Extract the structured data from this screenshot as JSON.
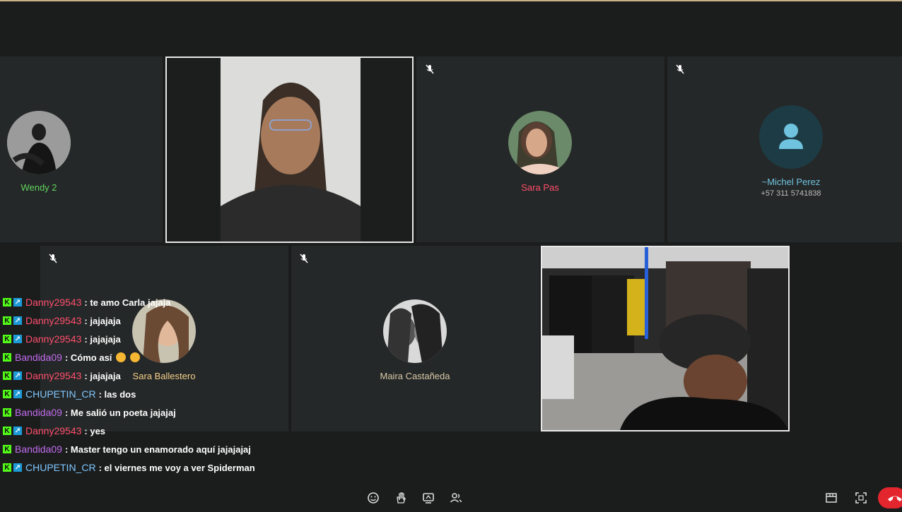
{
  "participants": {
    "wendy": {
      "name": "Wendy 2",
      "name_color": "#5fd45f"
    },
    "sara_pas": {
      "name": "Sara Pas",
      "name_color": "#ff4d6a"
    },
    "michel": {
      "name": "~Michel Perez",
      "phone": "+57 311 5741838",
      "name_color": "#6fc3df"
    },
    "sara_ballestero": {
      "name": "Sara Ballestero",
      "name_color": "#f5d08a"
    },
    "maira": {
      "name": "Maira Castañeda",
      "name_color": "#d8c8a8"
    }
  },
  "chat": {
    "messages": [
      {
        "user": "Danny29543",
        "color": "#ff4f6d",
        "text": ": te amo Carla jajaja",
        "badge2": true,
        "emojis": []
      },
      {
        "user": "Danny29543",
        "color": "#ff4f6d",
        "text": ": jajajaja",
        "badge2": true,
        "emojis": []
      },
      {
        "user": "Danny29543",
        "color": "#ff4f6d",
        "text": ": jajajaja",
        "badge2": true,
        "emojis": []
      },
      {
        "user": "Bandida09",
        "color": "#c36cf0",
        "text": ": Cómo así",
        "badge2": false,
        "emojis": [
          "#f7b733",
          "#f7b733"
        ]
      },
      {
        "user": "Danny29543",
        "color": "#ff4f6d",
        "text": ": jajajaja",
        "badge2": true,
        "emojis": []
      },
      {
        "user": "CHUPETIN_CR",
        "color": "#7fc7ff",
        "text": ": las dos",
        "badge2": true,
        "emojis": []
      },
      {
        "user": "Bandida09",
        "color": "#c36cf0",
        "text": ": Me salió un poeta jajajaj",
        "badge2": false,
        "emojis": []
      },
      {
        "user": "Danny29543",
        "color": "#ff4f6d",
        "text": ": yes",
        "badge2": true,
        "emojis": []
      },
      {
        "user": "Bandida09",
        "color": "#c36cf0",
        "text": ": Master tengo un enamorado aquí jajajajaj",
        "badge2": false,
        "emojis": []
      },
      {
        "user": "CHUPETIN_CR",
        "color": "#7fc7ff",
        "text": ": el viernes me voy a ver Spiderman",
        "badge2": true,
        "emojis": []
      }
    ]
  },
  "colors": {
    "background": "#1b1d1d",
    "tile": "#252828",
    "hangup": "#e3262d"
  },
  "icons": {
    "toolbar": [
      "emoji-icon",
      "raise-hand-icon",
      "share-screen-icon",
      "participants-icon",
      "layout-icon",
      "fullscreen-icon",
      "hangup-icon"
    ]
  }
}
